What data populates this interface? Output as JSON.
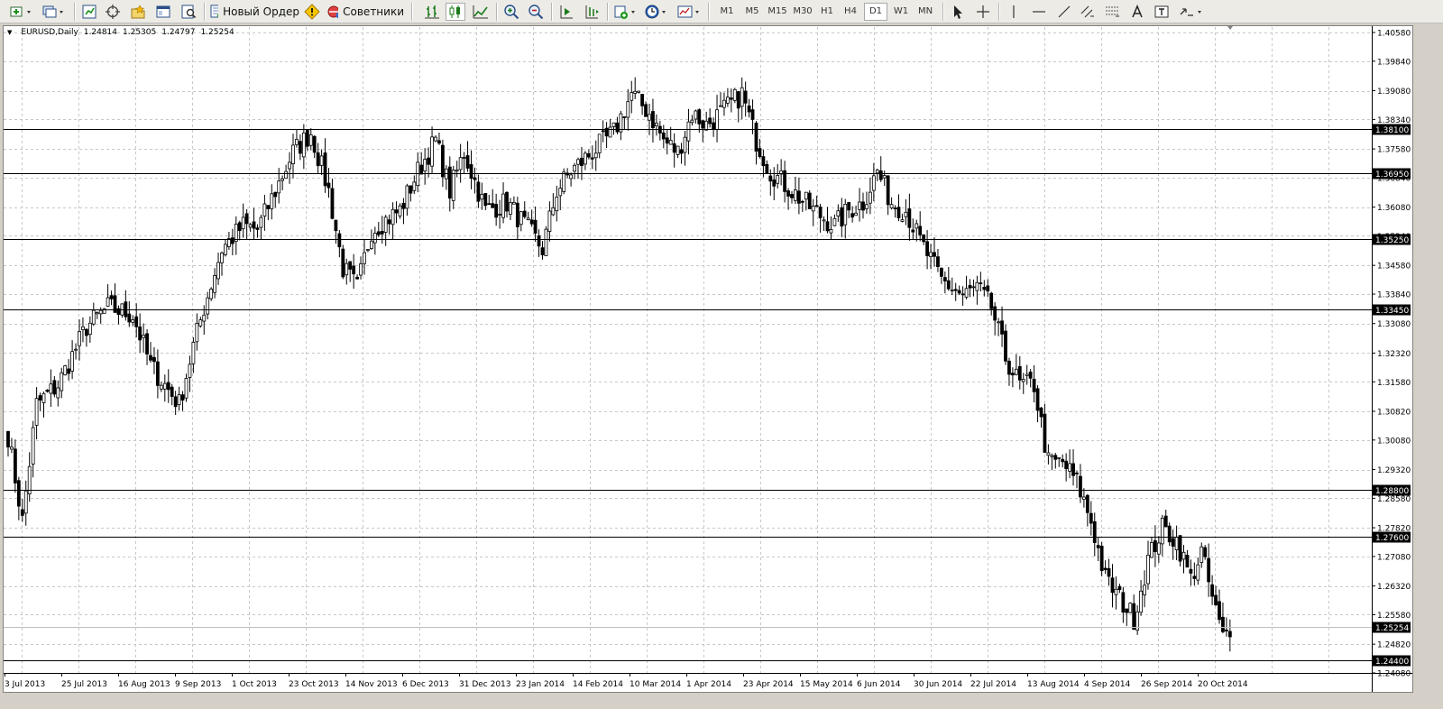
{
  "symbol": {
    "name": "EURUSD,Daily",
    "open": "1.24814",
    "high": "1.25305",
    "low": "1.24797",
    "close": "1.25254"
  },
  "toolbar": {
    "new_order_label": "Новый Ордер",
    "advisors_label": "Советники",
    "active_timeframe": "D1",
    "timeframes": [
      "M1",
      "M5",
      "M15",
      "M30",
      "H1",
      "H4",
      "D1",
      "W1",
      "MN"
    ]
  },
  "chart_data": {
    "type": "candlestick",
    "ylim": [
      1.2408,
      1.4058
    ],
    "price_ticks": [
      "1.40580",
      "1.39840",
      "1.39080",
      "1.38340",
      "1.37580",
      "1.36840",
      "1.36080",
      "1.35340",
      "1.34580",
      "1.33840",
      "1.33080",
      "1.32320",
      "1.31580",
      "1.30820",
      "1.30080",
      "1.29320",
      "1.28580",
      "1.27820",
      "1.27080",
      "1.26320",
      "1.25580",
      "1.24820",
      "1.24080"
    ],
    "date_labels": [
      "3 Jul 2013",
      "25 Jul 2013",
      "16 Aug 2013",
      "9 Sep 2013",
      "1 Oct 2013",
      "23 Oct 2013",
      "14 Nov 2013",
      "6 Dec 2013",
      "31 Dec 2013",
      "23 Jan 2014",
      "14 Feb 2014",
      "10 Mar 2014",
      "1 Apr 2014",
      "23 Apr 2014",
      "15 May 2014",
      "6 Jun 2014",
      "30 Jun 2014",
      "22 Jul 2014",
      "13 Aug 2014",
      "4 Sep 2014",
      "26 Sep 2014",
      "20 Oct 2014"
    ],
    "horizontal_levels": [
      {
        "price": 1.381,
        "label": "1.38100"
      },
      {
        "price": 1.3695,
        "label": "1.36950"
      },
      {
        "price": 1.3525,
        "label": "1.35250"
      },
      {
        "price": 1.3345,
        "label": "1.33450"
      },
      {
        "price": 1.288,
        "label": "1.28800"
      },
      {
        "price": 1.276,
        "label": "1.27600"
      },
      {
        "price": 1.244,
        "label": "1.24400"
      }
    ],
    "bid": {
      "price": 1.25254,
      "label": "1.25254"
    },
    "ohlc_anchor_closes": [
      [
        0,
        1.302
      ],
      [
        4,
        1.28
      ],
      [
        8,
        1.31
      ],
      [
        14,
        1.315
      ],
      [
        22,
        1.33
      ],
      [
        28,
        1.335
      ],
      [
        35,
        1.333
      ],
      [
        40,
        1.32
      ],
      [
        44,
        1.315
      ],
      [
        48,
        1.31
      ],
      [
        52,
        1.325
      ],
      [
        55,
        1.335
      ],
      [
        60,
        1.35
      ],
      [
        66,
        1.356
      ],
      [
        70,
        1.355
      ],
      [
        75,
        1.365
      ],
      [
        80,
        1.375
      ],
      [
        85,
        1.38
      ],
      [
        90,
        1.365
      ],
      [
        94,
        1.345
      ],
      [
        98,
        1.34
      ],
      [
        102,
        1.355
      ],
      [
        110,
        1.36
      ],
      [
        115,
        1.37
      ],
      [
        120,
        1.378
      ],
      [
        124,
        1.365
      ],
      [
        128,
        1.375
      ],
      [
        134,
        1.36
      ],
      [
        140,
        1.362
      ],
      [
        146,
        1.355
      ],
      [
        150,
        1.35
      ],
      [
        154,
        1.365
      ],
      [
        158,
        1.37
      ],
      [
        164,
        1.375
      ],
      [
        170,
        1.38
      ],
      [
        175,
        1.39
      ],
      [
        180,
        1.385
      ],
      [
        184,
        1.378
      ],
      [
        188,
        1.375
      ],
      [
        192,
        1.385
      ],
      [
        196,
        1.382
      ],
      [
        200,
        1.385
      ],
      [
        206,
        1.39
      ],
      [
        210,
        1.378
      ],
      [
        214,
        1.37
      ],
      [
        220,
        1.365
      ],
      [
        226,
        1.36
      ],
      [
        232,
        1.356
      ],
      [
        236,
        1.36
      ],
      [
        240,
        1.362
      ],
      [
        244,
        1.37
      ],
      [
        248,
        1.362
      ],
      [
        252,
        1.36
      ],
      [
        256,
        1.352
      ],
      [
        262,
        1.342
      ],
      [
        268,
        1.338
      ],
      [
        272,
        1.34
      ],
      [
        276,
        1.335
      ],
      [
        280,
        1.322
      ],
      [
        284,
        1.315
      ],
      [
        288,
        1.315
      ],
      [
        292,
        1.295
      ],
      [
        296,
        1.295
      ],
      [
        300,
        1.29
      ],
      [
        304,
        1.28
      ],
      [
        308,
        1.265
      ],
      [
        312,
        1.26
      ],
      [
        316,
        1.255
      ],
      [
        320,
        1.27
      ],
      [
        324,
        1.278
      ],
      [
        328,
        1.275
      ],
      [
        332,
        1.265
      ],
      [
        335,
        1.272
      ],
      [
        338,
        1.26
      ],
      [
        341,
        1.25
      ],
      [
        343,
        1.2525
      ]
    ]
  }
}
